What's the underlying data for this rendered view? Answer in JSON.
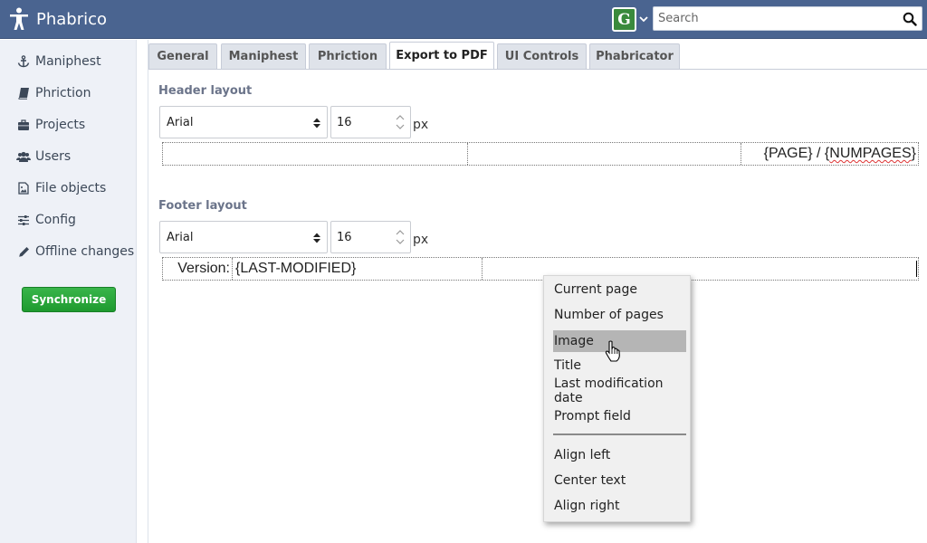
{
  "app": {
    "name": "Phabrico"
  },
  "header": {
    "user_initial": "G",
    "search": {
      "placeholder": "Search",
      "value": ""
    }
  },
  "sidebar": {
    "items": [
      {
        "label": "Maniphest",
        "icon": "anchor-icon"
      },
      {
        "label": "Phriction",
        "icon": "book-icon"
      },
      {
        "label": "Projects",
        "icon": "briefcase-icon"
      },
      {
        "label": "Users",
        "icon": "users-icon"
      },
      {
        "label": "File objects",
        "icon": "file-image-icon"
      },
      {
        "label": "Config",
        "icon": "sliders-icon"
      },
      {
        "label": "Offline changes",
        "icon": "pencil-icon"
      }
    ],
    "sync_label": "Synchronize"
  },
  "tabs": [
    {
      "label": "General",
      "active": false
    },
    {
      "label": "Maniphest",
      "active": false
    },
    {
      "label": "Phriction",
      "active": false
    },
    {
      "label": "Export to PDF",
      "active": true
    },
    {
      "label": "UI Controls",
      "active": false
    },
    {
      "label": "Phabricator",
      "active": false
    }
  ],
  "header_layout": {
    "title": "Header layout",
    "font": "Arial",
    "size": "16",
    "unit": "px",
    "cells": [
      "",
      "",
      "{PAGE} / {NUMPAGES}"
    ]
  },
  "footer_layout": {
    "title": "Footer layout",
    "font": "Arial",
    "size": "16",
    "unit": "px",
    "cells": [
      "Version:",
      "{LAST-MODIFIED}",
      ""
    ]
  },
  "context_menu": {
    "items": [
      "Current page",
      "Number of pages",
      "Image",
      "Title",
      "Last modification date",
      "Prompt field"
    ],
    "highlighted": "Image",
    "align_items": [
      "Align left",
      "Center text",
      "Align right"
    ]
  },
  "colors": {
    "topbar": "#4a6490",
    "sidebar_bg": "#eef1f7",
    "sync_green": "#2aa63a",
    "avatar_green": "#3a8a3c",
    "menu_highlight": "#b5b5b5"
  }
}
